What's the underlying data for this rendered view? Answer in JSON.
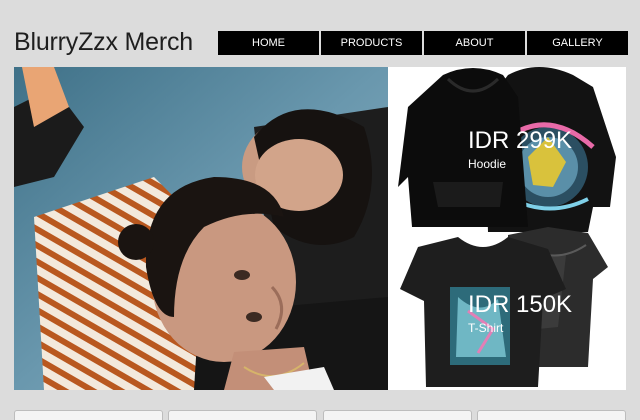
{
  "header": {
    "title": "BlurryZzx Merch"
  },
  "nav": {
    "items": [
      {
        "label": "HOME"
      },
      {
        "label": "PRODUCTS"
      },
      {
        "label": "ABOUT"
      },
      {
        "label": "GALLERY"
      }
    ]
  },
  "products": [
    {
      "price": "IDR 299K",
      "name": "Hoodie"
    },
    {
      "price": "IDR 150K",
      "name": "T-Shirt"
    }
  ],
  "colors": {
    "background": "#dcdcdc",
    "nav_background": "#000000",
    "nav_text": "#ffffff",
    "photo_background": "#5a88a0"
  }
}
